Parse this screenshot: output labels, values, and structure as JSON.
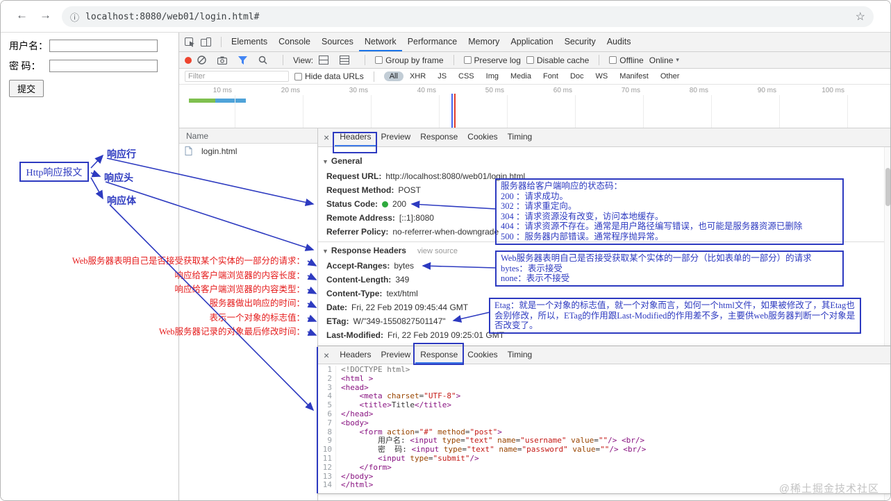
{
  "colors": {
    "annotation_blue": "#2d3ac0",
    "note_red": "#e51c1c",
    "status_green": "#2faa3e",
    "devtools_accent": "#1a73e8"
  },
  "icons": {
    "back": "←",
    "forward": "→",
    "star": "☆",
    "info": "ⓘ",
    "close": "×",
    "triangle_down": "▼",
    "caret_down": "▾"
  },
  "browser": {
    "url": "localhost:8080/web01/login.html#"
  },
  "login_form": {
    "username_label": "用户名：",
    "password_label": "密 码：",
    "username_value": "",
    "password_value": "",
    "submit_label": "提交"
  },
  "devtools": {
    "tabs": [
      "Elements",
      "Console",
      "Sources",
      "Network",
      "Performance",
      "Memory",
      "Application",
      "Security",
      "Audits"
    ],
    "active_tab": "Network",
    "toolbar": {
      "view_label": "View:",
      "group_by_frame": "Group by frame",
      "preserve_log": "Preserve log",
      "disable_cache": "Disable cache",
      "offline": "Offline",
      "online": "Online"
    },
    "filter_bar": {
      "placeholder": "Filter",
      "hide_data_urls": "Hide data URLs",
      "types": [
        "All",
        "XHR",
        "JS",
        "CSS",
        "Img",
        "Media",
        "Font",
        "Doc",
        "WS",
        "Manifest",
        "Other"
      ],
      "active_type": "All"
    },
    "timeline_ticks": [
      "10 ms",
      "20 ms",
      "30 ms",
      "40 ms",
      "50 ms",
      "60 ms",
      "70 ms",
      "80 ms",
      "90 ms",
      "100 ms"
    ],
    "request_list": {
      "name_header": "Name",
      "items": [
        "login.html"
      ]
    },
    "detail_tabs": [
      "Headers",
      "Preview",
      "Response",
      "Cookies",
      "Timing"
    ],
    "detail_active": "Headers",
    "general": {
      "title": "General",
      "rows": [
        {
          "key": "Request URL:",
          "value": "http://localhost:8080/web01/login.html"
        },
        {
          "key": "Request Method:",
          "value": "POST"
        },
        {
          "key": "Status Code:",
          "value": "200",
          "status_dot": true
        },
        {
          "key": "Remote Address:",
          "value": "[::1]:8080"
        },
        {
          "key": "Referrer Policy:",
          "value": "no-referrer-when-downgrade"
        }
      ]
    },
    "response_headers": {
      "title": "Response Headers",
      "view_source_label": "view source",
      "rows": [
        {
          "key": "Accept-Ranges:",
          "value": "bytes"
        },
        {
          "key": "Content-Length:",
          "value": "349"
        },
        {
          "key": "Content-Type:",
          "value": "text/html"
        },
        {
          "key": "Date:",
          "value": "Fri, 22 Feb 2019 09:45:44 GMT"
        },
        {
          "key": "ETag:",
          "value": "W/\"349-1550827501147\""
        },
        {
          "key": "Last-Modified:",
          "value": "Fri, 22 Feb 2019 09:25:01 GMT"
        }
      ]
    },
    "response_panel": {
      "tabs": [
        "Headers",
        "Preview",
        "Response",
        "Cookies",
        "Timing"
      ],
      "active": "Response",
      "code_lines": [
        "<!DOCTYPE html>",
        "<html >",
        "<head>",
        "    <meta charset=\"UTF-8\">",
        "    <title>Title</title>",
        "</head>",
        "<body>",
        "    <form action=\"#\" method=\"post\">",
        "        用户名: <input type=\"text\" name=\"username\" value=\"\"/> <br/>",
        "        密  码: <input type=\"text\" name=\"password\" value=\"\"/> <br/>",
        "        <input type=\"submit\"/>",
        "    </form>",
        "</body>",
        "</html>"
      ]
    }
  },
  "annotations": {
    "report_box": "Http响应报文",
    "parts": [
      "响应行",
      "响应头",
      "响应体"
    ],
    "red_notes": [
      "Web服务器表明自己是否接受获取某个实体的一部分的请求：",
      "响应给客户端浏览器的内容长度：",
      "响应给客户端浏览器的内容类型：",
      "服务器做出响应的时间：",
      "表示一个对象的标志值：",
      "Web服务器记录的对象最后修改时间："
    ],
    "status_codes_note": "服务器给客户端响应的状态码：\n200 ：请求成功。\n302 ：请求重定向。\n304 ：请求资源没有改变，访问本地缓存。\n404 ：请求资源不存在。通常是用户路径编写错误，也可能是服务器资源已删除\n500 ：服务器内部错误。通常程序抛异常。",
    "accept_ranges_note": "Web服务器表明自己是否接受获取某个实体的一部分（比如表单的一部分）的请求\nbytes：表示接受\nnone：表示不接受",
    "etag_note": "Etag：就是一个对象的标志值，就一个对象而言，如何一个html文件，如果被修改了，其Etag也会别修改，所以，ETag的作用跟Last-Modified的作用差不多，主要供web服务器判断一个对象是否改变了。"
  },
  "watermark": "@稀土掘金技术社区"
}
